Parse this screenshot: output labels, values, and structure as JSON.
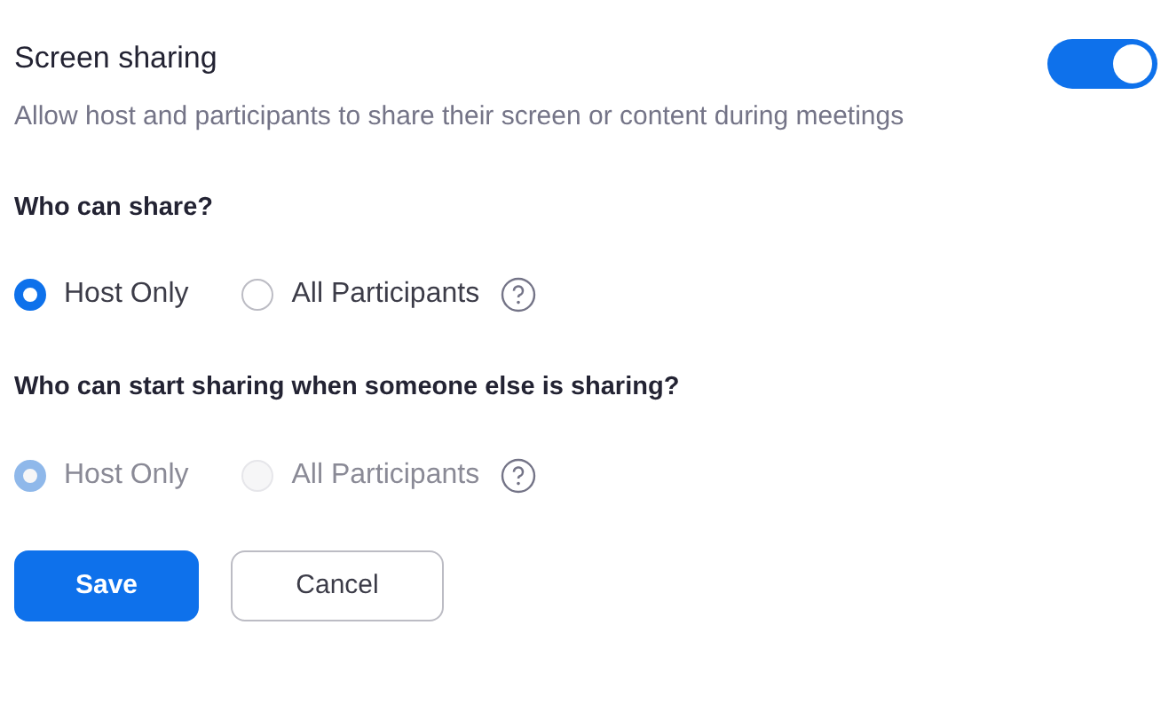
{
  "setting": {
    "title": "Screen sharing",
    "description": "Allow host and participants to share their screen or content during meetings",
    "on": true
  },
  "groups": [
    {
      "heading": "Who can share?",
      "disabled": false,
      "options": [
        {
          "label": "Host Only",
          "selected": true
        },
        {
          "label": "All Participants",
          "selected": false
        }
      ]
    },
    {
      "heading": "Who can start sharing when someone else is sharing?",
      "disabled": true,
      "options": [
        {
          "label": "Host Only",
          "selected": true
        },
        {
          "label": "All Participants",
          "selected": false
        }
      ]
    }
  ],
  "buttons": [
    {
      "label": "Save",
      "kind": "primary"
    },
    {
      "label": "Cancel",
      "kind": "secondary"
    }
  ]
}
